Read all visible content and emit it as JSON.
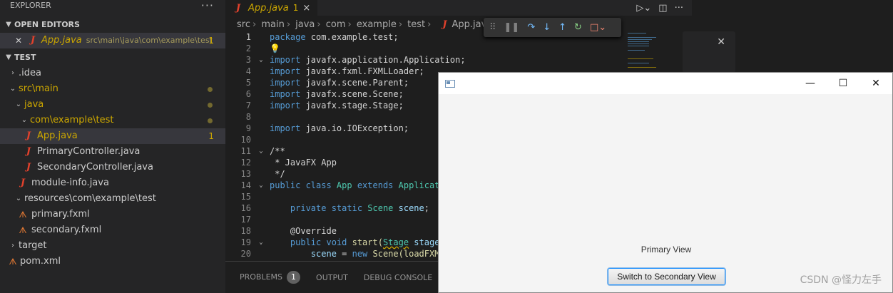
{
  "sidebar": {
    "title": "EXPLORER",
    "more": "···",
    "open_editors_header": "OPEN EDITORS",
    "open_editor": {
      "name": "App.java",
      "path": "src\\main\\java\\com\\example\\test",
      "count": "1"
    },
    "project_header": "TEST",
    "tree": [
      {
        "label": ".idea"
      },
      {
        "label": "src\\main"
      },
      {
        "label": "java"
      },
      {
        "label": "com\\example\\test"
      },
      {
        "label": "App.java",
        "badge": "1"
      },
      {
        "label": "PrimaryController.java"
      },
      {
        "label": "SecondaryController.java"
      },
      {
        "label": "module-info.java"
      },
      {
        "label": "resources\\com\\example\\test"
      },
      {
        "label": "primary.fxml"
      },
      {
        "label": "secondary.fxml"
      },
      {
        "label": "target"
      },
      {
        "label": "pom.xml"
      }
    ]
  },
  "editor": {
    "tab": {
      "name": "App.java",
      "count": "1",
      "close": "×"
    },
    "breadcrumb": [
      "src",
      "main",
      "java",
      "com",
      "example",
      "test",
      "App.java"
    ],
    "lines": [
      "1",
      "2",
      "3",
      "4",
      "5",
      "6",
      "7",
      "8",
      "9",
      "10",
      "11",
      "12",
      "13",
      "14",
      "15",
      "16",
      "17",
      "18",
      "19",
      "20"
    ]
  },
  "code": {
    "l1_kw": "package",
    "l1_rest": " com.example.test;",
    "l3_kw": "import",
    "l3_rest": " javafx.application.Application;",
    "l4_kw": "import",
    "l4_rest": " javafx.fxml.FXMLLoader;",
    "l5_kw": "import",
    "l5_rest": " javafx.scene.Parent;",
    "l6_kw": "import",
    "l6_rest": " javafx.scene.Scene;",
    "l7_kw": "import",
    "l7_rest": " javafx.stage.Stage;",
    "l9_kw": "import",
    "l9_rest": " java.io.IOException;",
    "l11": "/**",
    "l12": " * JavaFX App",
    "l13": " */",
    "l14_a": "public class",
    "l14_b": " App ",
    "l14_c": "extends",
    "l14_d": " Application",
    "l16_a": "    private static",
    "l16_b": " Scene",
    "l16_c": " scene",
    "l18": "    @Override",
    "l19_a": "    public void",
    "l19_b": " start(",
    "l19_c": "Stage",
    "l19_d": " stage) t",
    "l20_a": "        scene",
    "l20_b": " = ",
    "l20_c": "new",
    "l20_d": " Scene(loadFXML(f"
  },
  "panel": {
    "problems": "PROBLEMS",
    "problems_count": "1",
    "output": "OUTPUT",
    "debug_console": "DEBUG CONSOLE"
  },
  "fx_window": {
    "minimize": "—",
    "maximize": "☐",
    "close": "✕",
    "label": "Primary View",
    "button": "Switch to Secondary View"
  },
  "watermark": "CSDN @怪力左手",
  "colors": {
    "editor_bg": "#1e1e1e",
    "sidebar_bg": "#252526",
    "warning": "#cca700",
    "java_icon": "#e2412c",
    "fx_button_border": "#1e90ff"
  }
}
